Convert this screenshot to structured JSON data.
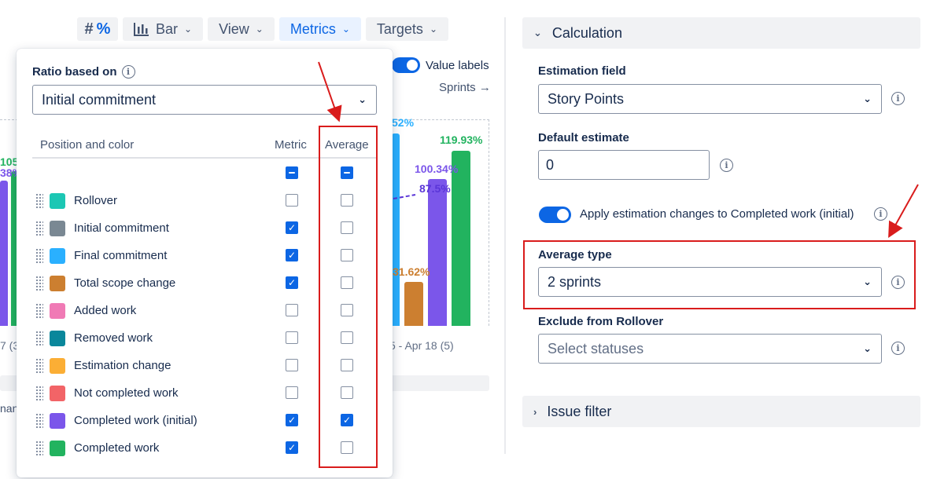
{
  "toolbar": {
    "hash": "#",
    "percent": "%",
    "chart_type_label": "Bar",
    "view_label": "View",
    "metrics_label": "Metrics",
    "targets_label": "Targets"
  },
  "chart": {
    "value_labels_toggle": "Value labels",
    "sprints_link": "Sprints →",
    "bar_labels": [
      "105",
      "38%",
      "52%",
      "100.34%",
      "87.5%",
      "119.93%",
      "31.62%"
    ],
    "x_labels": [
      "7 (3",
      "5 - Apr 18 (5)"
    ],
    "legend_fragment": "nan",
    "colors": {
      "completed_initial": "#7b56ea",
      "completed": "#22b35f",
      "final_commitment": "#2ab0ff",
      "total_scope": "#cc7f30"
    }
  },
  "popup": {
    "ratio_label": "Ratio based on",
    "ratio_value": "Initial commitment",
    "col_position": "Position and color",
    "col_metric": "Metric",
    "col_average": "Average",
    "rows": [
      {
        "label": "Rollover",
        "color": "#1cc7b4",
        "metric": false,
        "average": false
      },
      {
        "label": "Initial commitment",
        "color": "#7a8893",
        "metric": true,
        "average": false
      },
      {
        "label": "Final commitment",
        "color": "#2ab0ff",
        "metric": true,
        "average": false
      },
      {
        "label": "Total scope change",
        "color": "#cc7f30",
        "metric": true,
        "average": false
      },
      {
        "label": "Added work",
        "color": "#f07ab5",
        "metric": false,
        "average": false
      },
      {
        "label": "Removed work",
        "color": "#0a879b",
        "metric": false,
        "average": false
      },
      {
        "label": "Estimation change",
        "color": "#fbae35",
        "metric": false,
        "average": false
      },
      {
        "label": "Not completed work",
        "color": "#f26467",
        "metric": false,
        "average": false
      },
      {
        "label": "Completed work (initial)",
        "color": "#7b56ea",
        "metric": true,
        "average": true
      },
      {
        "label": "Completed work",
        "color": "#22b35f",
        "metric": true,
        "average": false
      }
    ]
  },
  "panel": {
    "calculation_title": "Calculation",
    "estimation_field_label": "Estimation field",
    "estimation_field_value": "Story Points",
    "default_estimate_label": "Default estimate",
    "default_estimate_value": "0",
    "apply_changes_label": "Apply estimation changes to Completed work (initial)",
    "average_type_label": "Average type",
    "average_type_value": "2 sprints",
    "exclude_label": "Exclude from Rollover",
    "exclude_placeholder": "Select statuses",
    "issue_filter_title": "Issue filter"
  }
}
